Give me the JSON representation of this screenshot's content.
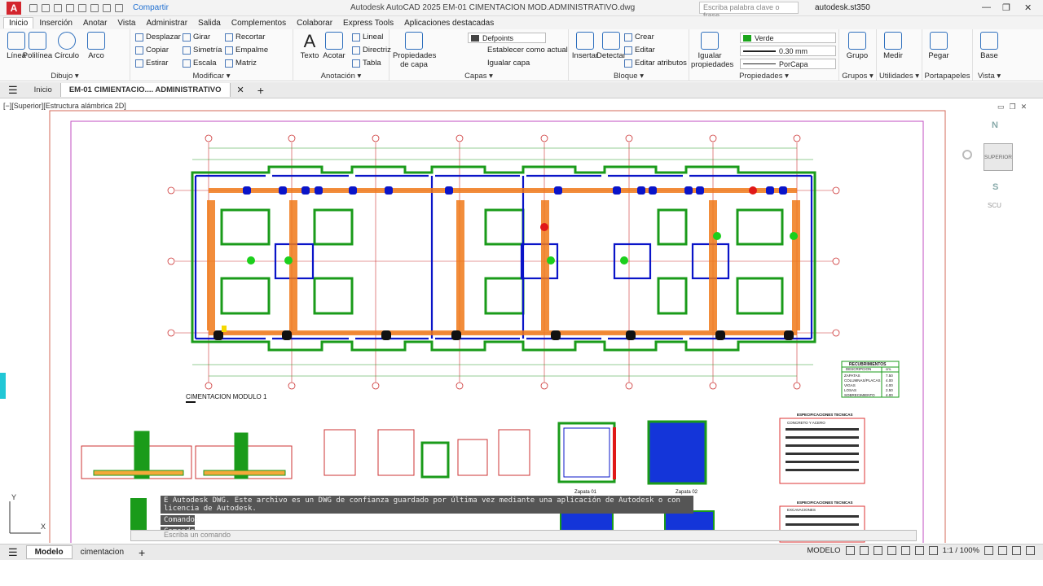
{
  "app": {
    "logo": "A",
    "title": "Autodesk AutoCAD 2025   EM-01 CIMENTACION MOD.ADMINISTRATIVO.dwg",
    "share": "Compartir",
    "search_placeholder": "Escriba palabra clave o frase",
    "user": "autodesk.st350"
  },
  "ribbon_tabs": [
    "Inicio",
    "Inserción",
    "Anotar",
    "Vista",
    "Administrar",
    "Salida",
    "Complementos",
    "Colaborar",
    "Express Tools",
    "Aplicaciones destacadas"
  ],
  "panels": {
    "dibujo": {
      "title": "Dibujo ▾",
      "buttons": [
        "Línea",
        "Polilínea",
        "Círculo",
        "Arco"
      ]
    },
    "modificar": {
      "title": "Modificar ▾",
      "buttons": [
        "Desplazar",
        "Girar",
        "Recortar",
        "Copiar",
        "Simetría",
        "Empalme",
        "Estirar",
        "Escala",
        "Matriz"
      ]
    },
    "anotacion": {
      "title": "Anotación ▾",
      "buttons": [
        "Texto",
        "Acotar",
        "Lineal",
        "Directriz",
        "Tabla"
      ]
    },
    "capas": {
      "title": "Capas ▾",
      "big": "Propiedades de capa",
      "layer": "Defpoints",
      "buttons": [
        "Establecer como actual",
        "Igualar capa"
      ]
    },
    "bloque": {
      "title": "Bloque ▾",
      "buttons": [
        "Insertar",
        "Detectar",
        "Crear",
        "Editar",
        "Editar atributos"
      ]
    },
    "propiedades": {
      "title": "Propiedades ▾",
      "big": "Igualar propiedades",
      "color": "Verde",
      "lineweight": "0.30 mm",
      "linetype": "PorCapa"
    },
    "grupos": {
      "title": "Grupos ▾",
      "big": "Grupo"
    },
    "utilidades": {
      "title": "Utilidades ▾",
      "big": "Medir"
    },
    "portapapeles": {
      "title": "Portapapeles",
      "big": "Pegar"
    },
    "vista": {
      "title": "Vista ▾",
      "big": "Base"
    }
  },
  "colors": {
    "green": "#1a9b1a",
    "blue": "#0a14c8",
    "orange": "#f07a1a",
    "red": "#d3262e"
  },
  "doc_tabs": [
    "Inicio",
    "EM-01 CIMIENTACIO.... ADMINISTRATIVO"
  ],
  "viewport_label": "[−][Superior][Estructura alámbrica 2D]",
  "viewcube": {
    "n": "N",
    "s": "S",
    "face": "SUPERIOR",
    "ucs": "SCU"
  },
  "drawing": {
    "title": "CIMENTACION MODULO 1",
    "grid_columns": [
      "1",
      "2",
      "3",
      "4",
      "5",
      "6",
      "7",
      "8"
    ],
    "grid_rows": [
      "C",
      "B",
      "A"
    ],
    "zapatas": [
      "Zapata 01",
      "Zapata 02"
    ],
    "recubrimientos": {
      "title": "RECUBRIMIENTOS",
      "headers": [
        "DESCRIPCION",
        "cm."
      ],
      "rows": [
        [
          "ZAPATAS",
          "7.50"
        ],
        [
          "COLUMNAS/PLACAS",
          "4.00"
        ],
        [
          "VIGAS",
          "4.00"
        ],
        [
          "LOSAS",
          "2.50"
        ],
        [
          "SOBRECIMIENTO",
          "4.00"
        ]
      ]
    },
    "specs_title": "ESPECIFICACIONES TECNICAS",
    "specs_sub1": "CONCRETO Y ACERO",
    "specs_sub2": "EXCAVACIONES",
    "cmd_message": "E Autodesk DWG. Este archivo es un DWG de confianza guardado por última vez mediante una aplicación de Autodesk o con licencia de Autodesk.",
    "cmd_label1": "Comando:",
    "cmd_label2": "Comando:",
    "cmd_placeholder": "Escriba un comando"
  },
  "layout_tabs": [
    "Modelo",
    "cimentacion"
  ],
  "status": {
    "space": "MODELO",
    "scale": "1:1 / 100%"
  }
}
